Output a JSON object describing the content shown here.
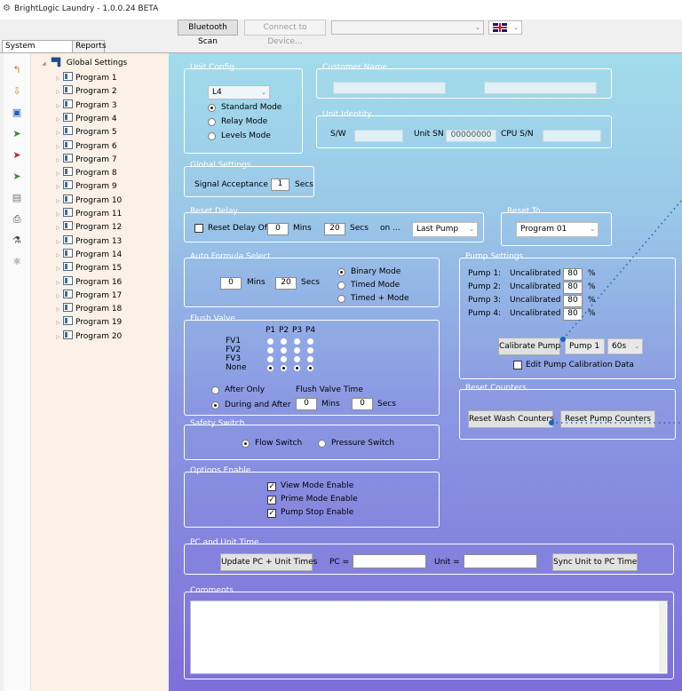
{
  "app": {
    "title": "BrightLogic Laundry - 1.0.0.24 BETA"
  },
  "toolbar": {
    "bluetooth_scan": "Bluetooth Scan",
    "connect": "Connect to Device...",
    "device_value": "",
    "language": "🇬🇧"
  },
  "tabs": [
    "System Settings",
    "Reports"
  ],
  "sidebar_icons": [
    "upload-icon",
    "download-icon",
    "save-icon",
    "send-icon",
    "receive-icon",
    "transfer-icon",
    "calculator-icon",
    "print-icon",
    "flask-icon",
    "chemical-icon"
  ],
  "tree": {
    "root": "Global Settings",
    "programs": [
      "Program 1",
      "Program 2",
      "Program 3",
      "Program 4",
      "Program 5",
      "Program 6",
      "Program 7",
      "Program 8",
      "Program 9",
      "Program 10",
      "Program 11",
      "Program 12",
      "Program 13",
      "Program 14",
      "Program 15",
      "Program 16",
      "Program 17",
      "Program 18",
      "Program 19",
      "Program 20"
    ]
  },
  "unit_config": {
    "title": "Unit Config",
    "unit_value": "L4",
    "modes": [
      "Standard Mode",
      "Relay Mode",
      "Levels Mode"
    ],
    "selected_mode": 0
  },
  "customer_name": {
    "title": "Customer Name"
  },
  "unit_identity": {
    "title": "Unit Identity",
    "sw_label": "S/W",
    "unit_sn_label": "Unit SN",
    "unit_sn_value": "00000000",
    "cpu_sn_label": "CPU S/N"
  },
  "global_settings": {
    "title": "Global Settings",
    "signal_label": "Signal Acceptance",
    "signal_value": "1",
    "secs": "Secs"
  },
  "reset_delay": {
    "title": "Reset Delay",
    "checkbox_label": "Reset Delay Off",
    "mins_value": "0",
    "mins": "Mins",
    "secs_value": "20",
    "secs": "Secs",
    "on_label": "on ...",
    "on_value": "Last Pump"
  },
  "reset_to": {
    "title": "Reset To",
    "value": "Program 01"
  },
  "auto_formula": {
    "title": "Auto Formula Select",
    "mins_value": "0",
    "mins": "Mins",
    "secs_value": "20",
    "secs": "Secs",
    "modes": [
      "Binary Mode",
      "Timed Mode",
      "Timed + Mode"
    ],
    "selected_mode": 0
  },
  "pump_settings": {
    "title": "Pump Settings",
    "pumps": [
      {
        "label": "Pump 1:",
        "status": "Uncalibrated",
        "value": "80",
        "unit": "%"
      },
      {
        "label": "Pump 2:",
        "status": "Uncalibrated",
        "value": "80",
        "unit": "%"
      },
      {
        "label": "Pump 3:",
        "status": "Uncalibrated",
        "value": "80",
        "unit": "%"
      },
      {
        "label": "Pump 4:",
        "status": "Uncalibrated",
        "value": "80",
        "unit": "%"
      }
    ],
    "calibrate_button": "Calibrate Pump",
    "pump_select": "Pump 1",
    "time_select": "60s",
    "edit_label": "Edit Pump Calibration Data"
  },
  "flush_valve": {
    "title": "Flush Valve",
    "columns": [
      "P1",
      "P2",
      "P3",
      "P4"
    ],
    "rows": [
      "FV1",
      "FV2",
      "FV3",
      "None"
    ],
    "options": [
      "After Only",
      "During and After"
    ],
    "selected_option": 1,
    "time_label": "Flush Valve Time",
    "mins_value": "0",
    "mins": "Mins",
    "secs_value": "0",
    "secs": "Secs"
  },
  "reset_counters": {
    "title": "Reset Counters",
    "wash_button": "Reset Wash Counters",
    "pump_button": "Reset Pump Counters"
  },
  "safety_switch": {
    "title": "Safety Switch",
    "options": [
      "Flow Switch",
      "Pressure Switch"
    ],
    "selected": 0
  },
  "options_enable": {
    "title": "Options Enable",
    "items": [
      "View Mode Enable",
      "Prime Mode Enable",
      "Pump Stop Enable"
    ]
  },
  "pc_unit_time": {
    "title": "PC and Unit Time",
    "update_button": "Update PC + Unit Times",
    "pc_label": "PC =",
    "unit_label": "Unit =",
    "sync_button": "Sync Unit to PC Time"
  },
  "comments": {
    "title": "Comments"
  },
  "colors": {
    "annotation": "#1565c0"
  }
}
